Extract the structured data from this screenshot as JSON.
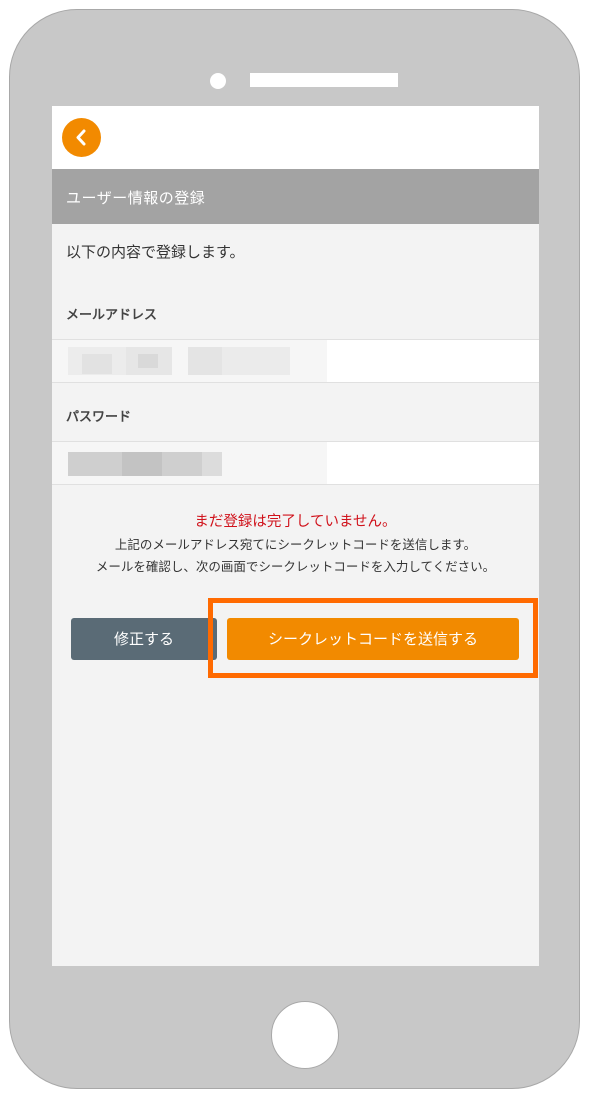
{
  "screen": {
    "section_title": "ユーザー情報の登録",
    "intro": "以下の内容で登録します。",
    "email_label": "メールアドレス",
    "password_label": "パスワード",
    "warning": "まだ登録は完了していません。",
    "note_line1": "上記のメールアドレス宛てにシークレットコードを送信します。",
    "note_line2": "メールを確認し、次の画面でシークレットコードを入力してください。",
    "edit_button": "修正する",
    "send_button": "シークレットコードを送信する"
  },
  "icons": {
    "back": "chevron-left-icon"
  },
  "colors": {
    "accent": "#f28a00",
    "header_gray": "#a3a3a3",
    "edit_button": "#5a6b76",
    "warning": "#d0121b",
    "highlight_box": "#ff6a00"
  }
}
